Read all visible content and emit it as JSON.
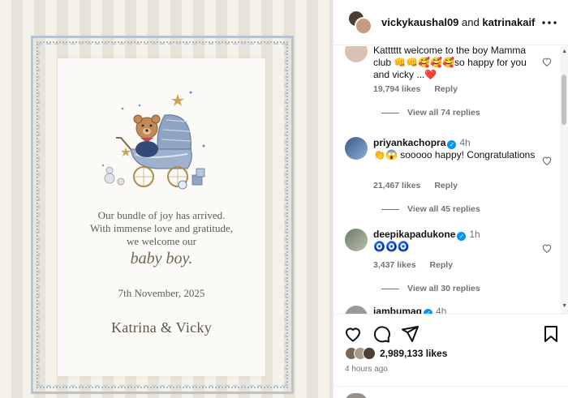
{
  "header": {
    "user1": "vickykaushal09",
    "and": "and",
    "user2": "katrinakaif"
  },
  "card": {
    "line1": "Our bundle of joy has arrived.",
    "line2": "With immense love and gratitude,",
    "line3": "we welcome our",
    "baby": "baby boy.",
    "date": "7th November, 2025",
    "names": "Katrina & Vicky"
  },
  "comments": [
    {
      "user": "",
      "text": "Katttttt welcome to the boy Mamma club 👊👊🥰🥰🥰so happy for you and vicky ...❤️",
      "likes": "19,794 likes",
      "reply": "Reply",
      "view_replies": "View all 74 replies"
    },
    {
      "user": "priyankachopra",
      "time": "4h",
      "text": "👏😱 sooooo happy! Congratulations",
      "likes": "21,467 likes",
      "reply": "Reply",
      "view_replies": "View all 45 replies"
    },
    {
      "user": "deepikapadukone",
      "time": "1h",
      "text": "🧿🧿🧿",
      "likes": "3,437 likes",
      "reply": "Reply",
      "view_replies": "View all 30 replies"
    },
    {
      "user": "iambumag",
      "time": "4h"
    }
  ],
  "footer": {
    "likes": "2,989,133 likes",
    "time_ago": "4 hours ago"
  },
  "colors": {
    "verified": "#0095f6",
    "like_heart": "#ed4956"
  }
}
